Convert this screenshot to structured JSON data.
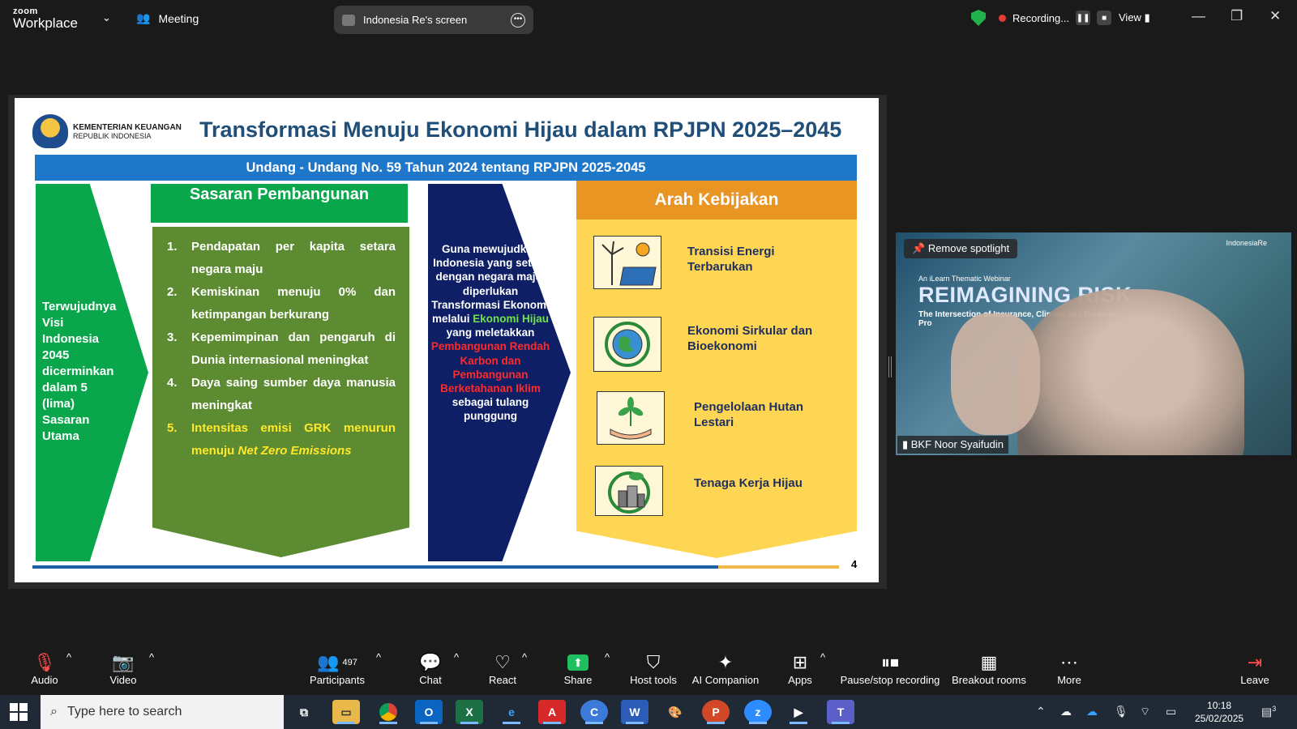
{
  "app": {
    "logo_top": "zoom",
    "logo_bottom": "Workplace",
    "meeting_label": "Meeting",
    "share_label": "Indonesia Re's screen",
    "recording_label": "Recording...",
    "view_label": "View"
  },
  "slide": {
    "ministry_line1": "KEMENTERIAN KEUANGAN",
    "ministry_line2": "REPUBLIK INDONESIA",
    "title": "Transformasi Menuju Ekonomi Hijau dalam RPJPN 2025–2045",
    "banner": "Undang - Undang No. 59 Tahun 2024 tentang RPJPN 2025-2045",
    "vision_text": "Terwujudnya Visi Indonesia 2045 dicerminkan dalam 5 (lima) Sasaran Utama",
    "sasaran_heading": "Sasaran Pembangunan",
    "sasaran_items": [
      {
        "num": "1.",
        "text": "Pendapatan per kapita setara negara maju"
      },
      {
        "num": "2.",
        "text": "Kemiskinan menuju 0% dan ketimpangan berkurang"
      },
      {
        "num": "3.",
        "text": "Kepemimpinan dan pengaruh di Dunia internasional meningkat"
      },
      {
        "num": "4.",
        "text": "Daya saing sumber daya manusia meningkat"
      }
    ],
    "sasaran_item5_num": "5.",
    "sasaran_item5_text": "Intensitas emisi GRK menurun menuju ",
    "sasaran_item5_em": "Net Zero Emissions",
    "transform_part1": "Guna mewujudkan Indonesia yang setara dengan negara maju, diperlukan Transformasi Ekonomi melalui",
    "transform_green": "Ekonomi Hijau",
    "transform_part2": "yang meletakkan",
    "transform_red": "Pembangunan Rendah Karbon dan Pembangunan Berketahanan Iklim",
    "transform_part3": "sebagai tulang punggung",
    "arah_heading": "Arah Kebijakan",
    "policies": [
      {
        "label": "Transisi Energi Terbarukan",
        "icon": "wind-solar-icon"
      },
      {
        "label": "Ekonomi Sirkular dan Bioekonomi",
        "icon": "recycle-globe-icon"
      },
      {
        "label": "Pengelolaan Hutan Lestari",
        "icon": "hand-plant-icon"
      },
      {
        "label": "Tenaga Kerja Hijau",
        "icon": "green-city-icon"
      }
    ],
    "page_number": "4",
    "progress": 0.85
  },
  "video": {
    "spotlight_label": "Remove spotlight",
    "participant_name": "BKF Noor Syaifudin",
    "bg_small": "An iLearn Thematic Webinar",
    "bg_title": "REIMAGINING RISK",
    "bg_subtitle": "The Intersection of Insurance, Climate and Disaster Pro",
    "bg_logo": "IndonesiaRe"
  },
  "toolbar": {
    "audio": "Audio",
    "video": "Video",
    "participants": "Participants",
    "participants_count": "497",
    "chat": "Chat",
    "react": "React",
    "share": "Share",
    "host_tools": "Host tools",
    "ai_companion": "AI Companion",
    "apps": "Apps",
    "pause_recording": "Pause/stop recording",
    "breakout": "Breakout rooms",
    "more": "More",
    "leave": "Leave"
  },
  "taskbar": {
    "search_placeholder": "Type here to search",
    "time": "10:18",
    "date": "25/02/2025",
    "notifications": "3"
  },
  "colors": {
    "green": "#0aa64b",
    "olive": "#5c8b32",
    "navy": "#0e1f66",
    "orange": "#e89524",
    "yellow": "#ffd653",
    "banner_blue": "#1f77c9"
  }
}
